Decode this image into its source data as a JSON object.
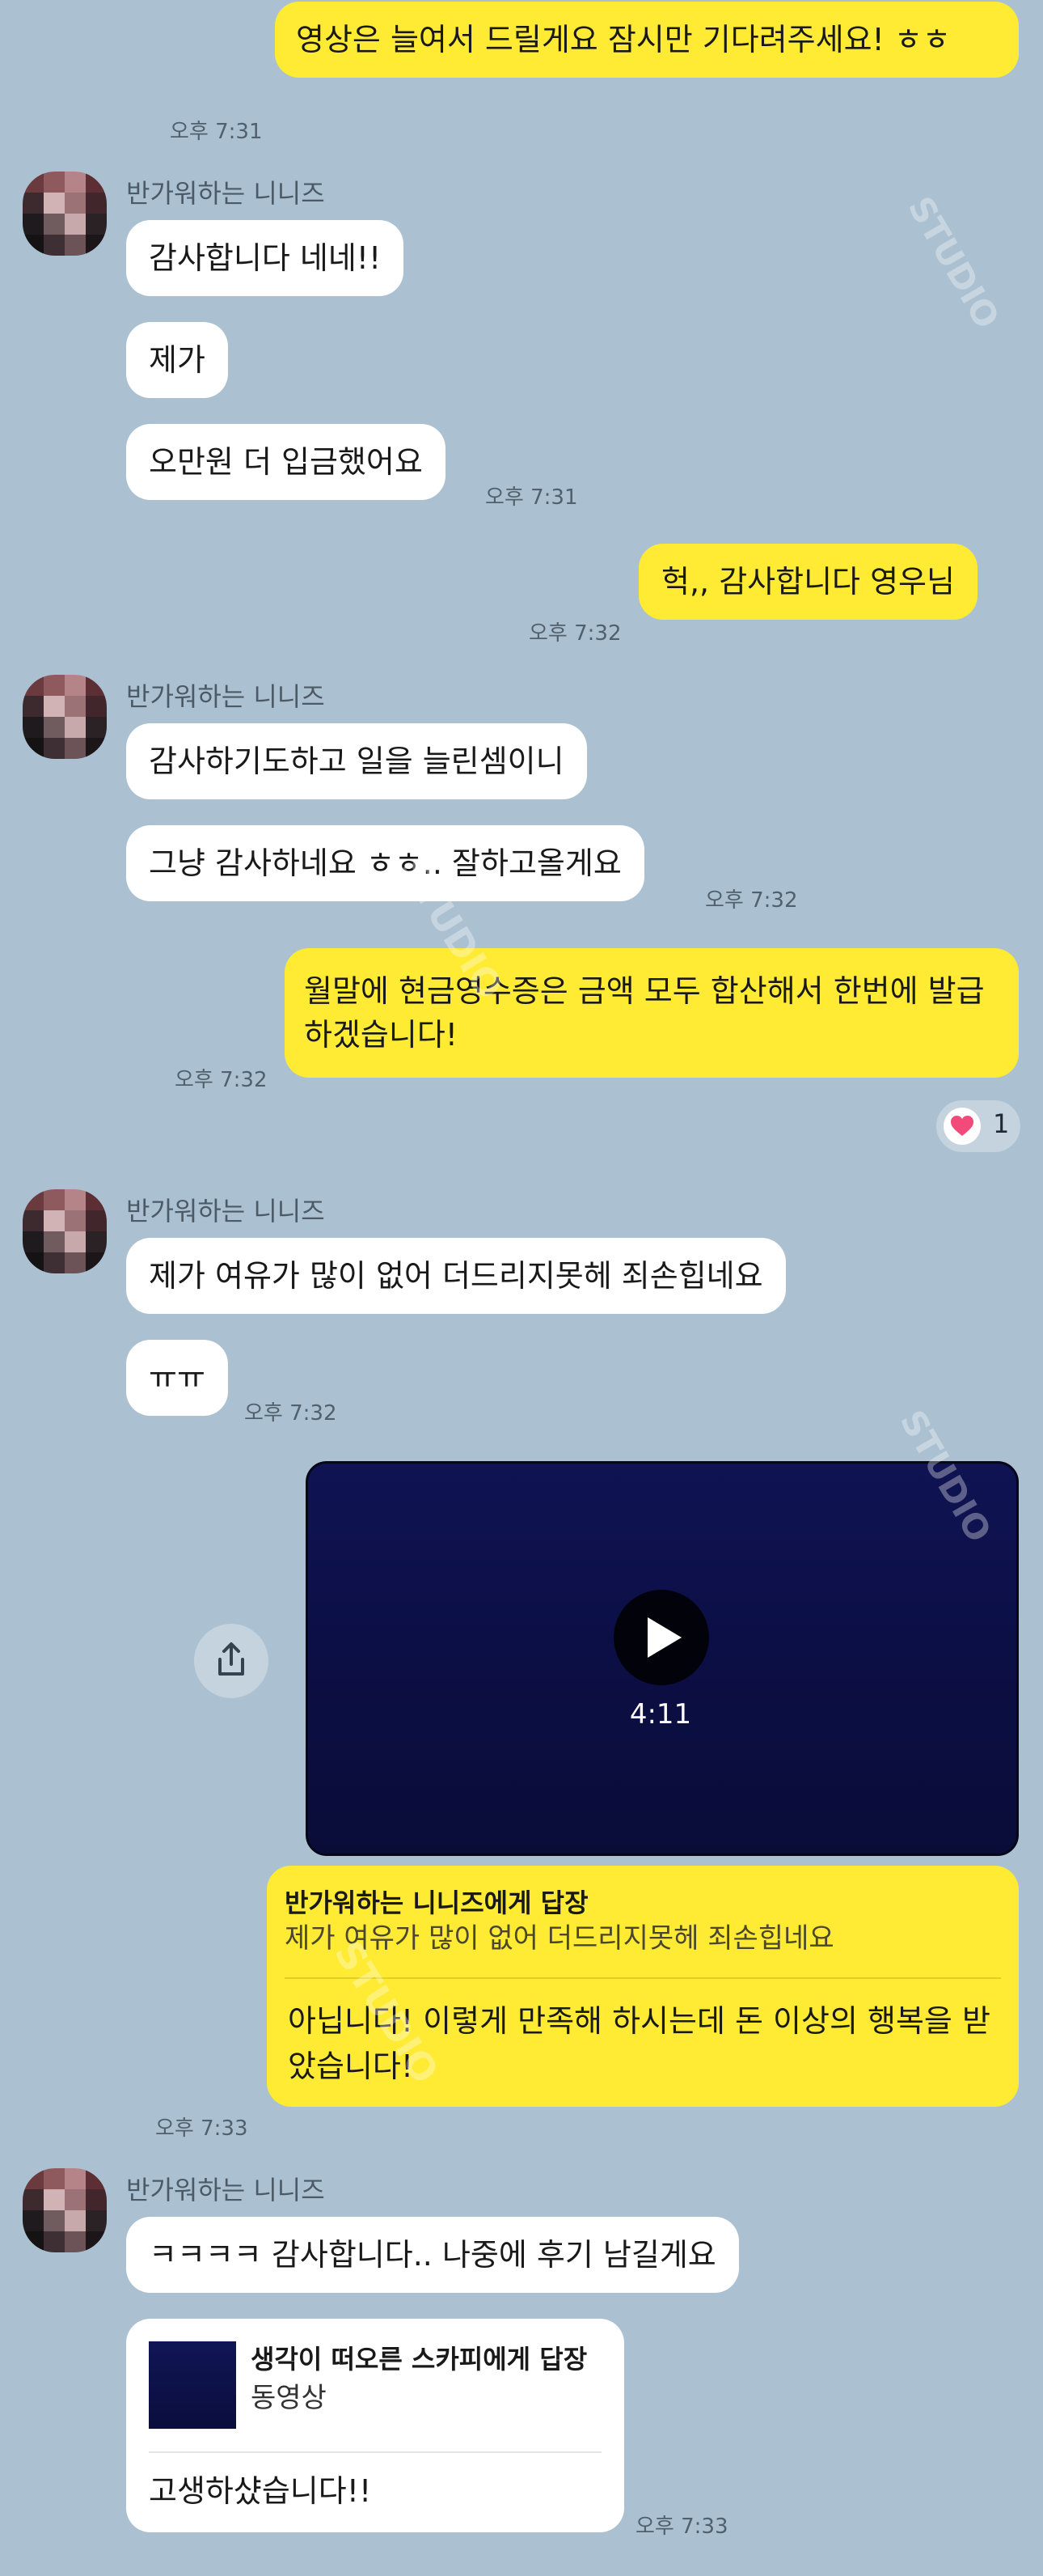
{
  "sender_name": "반가워하는 니니즈",
  "messages": {
    "m1": {
      "text": "영상은 늘여서 드릴게요 잠시만 기다려주세요! ㅎㅎ",
      "time": "오후 7:31"
    },
    "m2": {
      "text": "감사합니다 네네!!"
    },
    "m3": {
      "text": "제가"
    },
    "m4": {
      "text": "오만원 더 입금했어요",
      "time": "오후 7:31"
    },
    "m5": {
      "text": "헉,, 감사합니다 영우님",
      "time": "오후 7:32"
    },
    "m6": {
      "text": "감사하기도하고 일을 늘린셈이니"
    },
    "m7": {
      "text": "그냥 감사하네요 ㅎㅎ.. 잘하고올게요",
      "time": "오후 7:32"
    },
    "m8": {
      "text": "월말에 현금영수증은 금액 모두 합산해서 한번에 발급하겠습니다!",
      "time": "오후 7:32",
      "reaction_count": "1"
    },
    "m9": {
      "text": "제가 여유가 많이 없어 더드리지못헤 죄손힙네요"
    },
    "m10": {
      "text": "ㅠㅠ",
      "time": "오후 7:32"
    },
    "video": {
      "duration": "4:11"
    },
    "m11": {
      "reply_to": "반가워하는 니니즈에게 답장",
      "quote": "제가 여유가 많이 없어 더드리지못헤 죄손힙네요",
      "text": "아닙니다! 이렇게 만족해 하시는데 돈 이상의 행복을 받았습니다!",
      "time": "오후 7:33"
    },
    "m12": {
      "text": "ㅋㅋㅋㅋ 감사합니다.. 나중에 후기 남길게요"
    },
    "m13": {
      "reply_to": "생각이 떠오른 스카피에게 답장",
      "quote": "동영상",
      "text": "고생하샸습니다!!",
      "time": "오후 7:33"
    }
  },
  "watermark_text": "STUDIO"
}
